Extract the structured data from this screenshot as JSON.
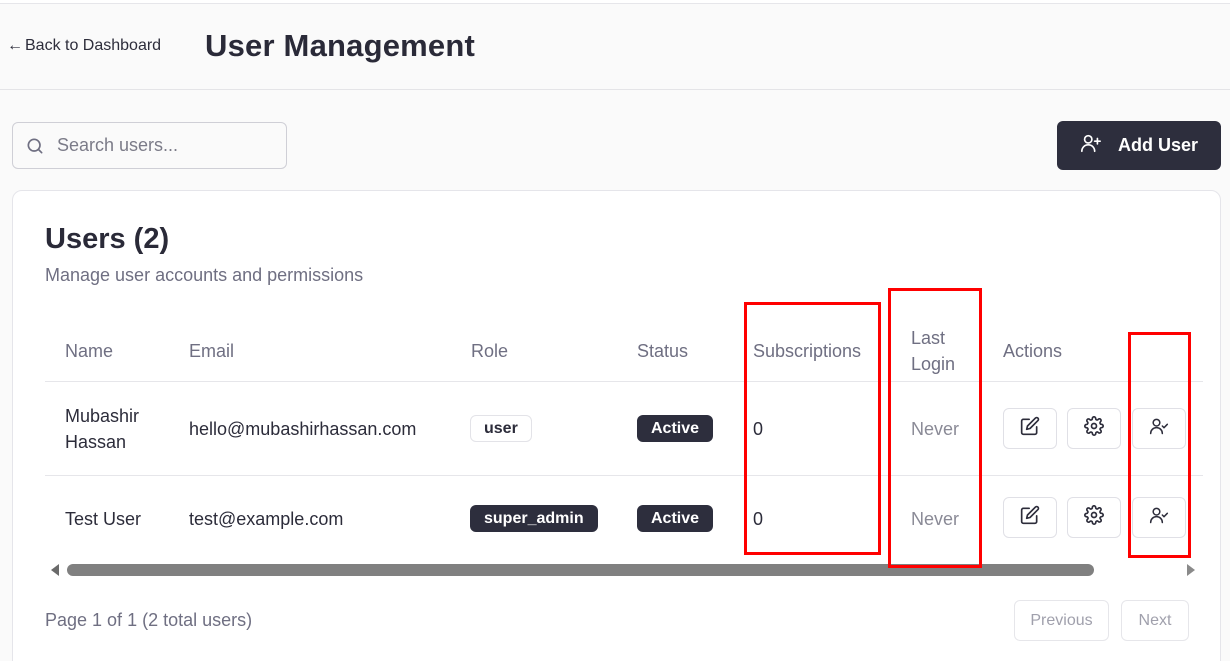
{
  "header": {
    "back_label": "Back to Dashboard",
    "back_arrow": "←",
    "title": "User Management"
  },
  "toolbar": {
    "search_placeholder": "Search users...",
    "add_user_label": "Add User"
  },
  "card": {
    "title": "Users (2)",
    "subtitle": "Manage user accounts and permissions"
  },
  "table": {
    "columns": {
      "name": "Name",
      "email": "Email",
      "role": "Role",
      "status": "Status",
      "subscriptions": "Subscriptions",
      "last_login_1": "Last",
      "last_login_2": "Login",
      "actions": "Actions"
    },
    "rows": [
      {
        "name_1": "Mubashir",
        "name_2": "Hassan",
        "email": "hello@mubashirhassan.com",
        "role": "user",
        "status": "Active",
        "subscriptions": "0",
        "last_login": "Never"
      },
      {
        "name": "Test User",
        "email": "test@example.com",
        "role": "super_admin",
        "status": "Active",
        "subscriptions": "0",
        "last_login": "Never"
      }
    ]
  },
  "pagination": {
    "summary": "Page 1 of 1 (2 total users)",
    "previous_label": "Previous",
    "next_label": "Next"
  },
  "icons": {
    "search": "search-icon",
    "add_user": "user-plus-icon",
    "edit": "edit-icon",
    "settings": "gear-icon",
    "user_check": "user-check-icon"
  },
  "colors": {
    "primary_dark": "#2d2e3d",
    "highlight": "#ff0000",
    "muted_text": "#6f6f82"
  }
}
